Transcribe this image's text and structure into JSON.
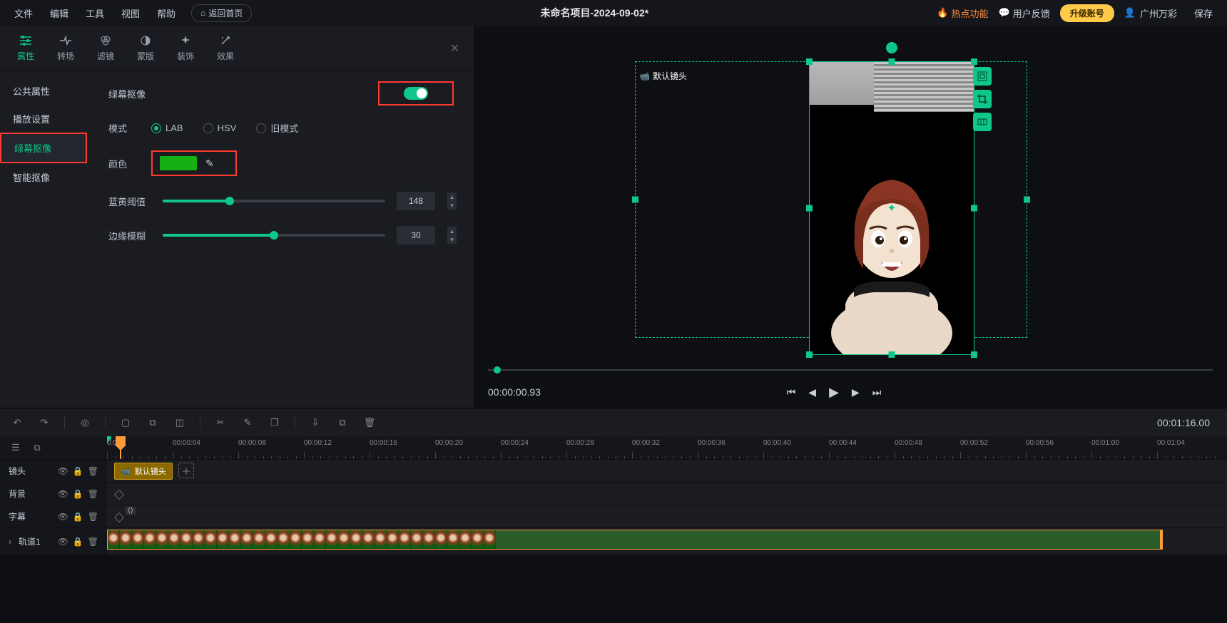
{
  "topbar": {
    "menu": [
      "文件",
      "编辑",
      "工具",
      "视图",
      "帮助"
    ],
    "back_home": "返回首页",
    "title": "未命名项目-2024-09-02*",
    "hot_feature": "热点功能",
    "feedback": "用户反馈",
    "upgrade": "升级账号",
    "user": "广州万彩",
    "save": "保存"
  },
  "tabs": [
    {
      "label": "属性",
      "icon": "sliders"
    },
    {
      "label": "转场",
      "icon": "transition"
    },
    {
      "label": "滤镜",
      "icon": "filter"
    },
    {
      "label": "蒙版",
      "icon": "mask"
    },
    {
      "label": "装饰",
      "icon": "decor"
    },
    {
      "label": "效果",
      "icon": "effect"
    }
  ],
  "side_tabs": {
    "items": [
      "公共属性",
      "播放设置",
      "绿幕抠像",
      "智能抠像"
    ],
    "active_index": 2
  },
  "props": {
    "title": "绿幕抠像",
    "mode_label": "模式",
    "mode_options": [
      "LAB",
      "HSV",
      "旧模式"
    ],
    "mode_selected": 0,
    "color_label": "颜色",
    "color_value": "#14b014",
    "threshold_label": "蓝黄阈值",
    "threshold_value": "148",
    "threshold_pct": 30,
    "blur_label": "边缘模糊",
    "blur_value": "30",
    "blur_pct": 50
  },
  "preview": {
    "camera_label": "默认镜头",
    "timecode": "00:00:00.93",
    "total_time": "00:01:16.00"
  },
  "ruler": {
    "ticks": [
      "0:00",
      "00:00:04",
      "00:00:08",
      "00:00:12",
      "00:00:16",
      "00:00:20",
      "00:00:24",
      "00:00:28",
      "00:00:32",
      "00:00:36",
      "00:00:40",
      "00:00:44",
      "00:00:48",
      "00:00:52",
      "00:00:56",
      "00:01:00",
      "00:01:04"
    ]
  },
  "tracks": {
    "shot": {
      "name": "镜头",
      "clip_label": "默认镜头"
    },
    "bg": {
      "name": "背景"
    },
    "subtitle": {
      "name": "字幕"
    },
    "track1": {
      "name": "轨道1"
    }
  }
}
